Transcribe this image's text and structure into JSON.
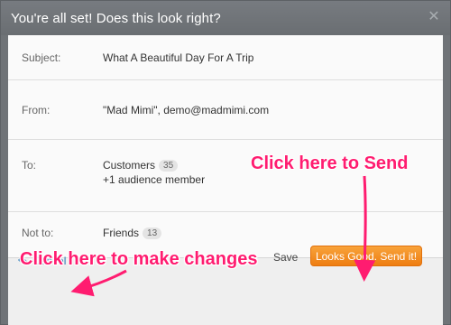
{
  "modal": {
    "title": "You're all set! Does this look right?",
    "close_icon": "close-icon"
  },
  "fields": {
    "subject": {
      "label": "Subject:",
      "value": "What A Beautiful Day For A Trip"
    },
    "from": {
      "label": "From:",
      "value": "\"Mad Mimi\", demo@madmimi.com"
    },
    "to": {
      "label": "To:",
      "list_name": "Customers",
      "list_count": "35",
      "extra": "+1 audience member"
    },
    "not_to": {
      "label": "Not to:",
      "list_name": "Friends",
      "list_count": "13"
    }
  },
  "footer": {
    "cancel_label": "Cancel",
    "cancel_icon": "undo-arrow-icon",
    "save_label": "Save",
    "send_label": "Looks Good. Send it!"
  },
  "annotations": {
    "send_hint": "Click here to Send",
    "changes_hint": "Click here to make changes",
    "color": "#ff1c70"
  },
  "colors": {
    "accent_orange": "#f28c1e",
    "link_blue": "#2a79b8"
  }
}
